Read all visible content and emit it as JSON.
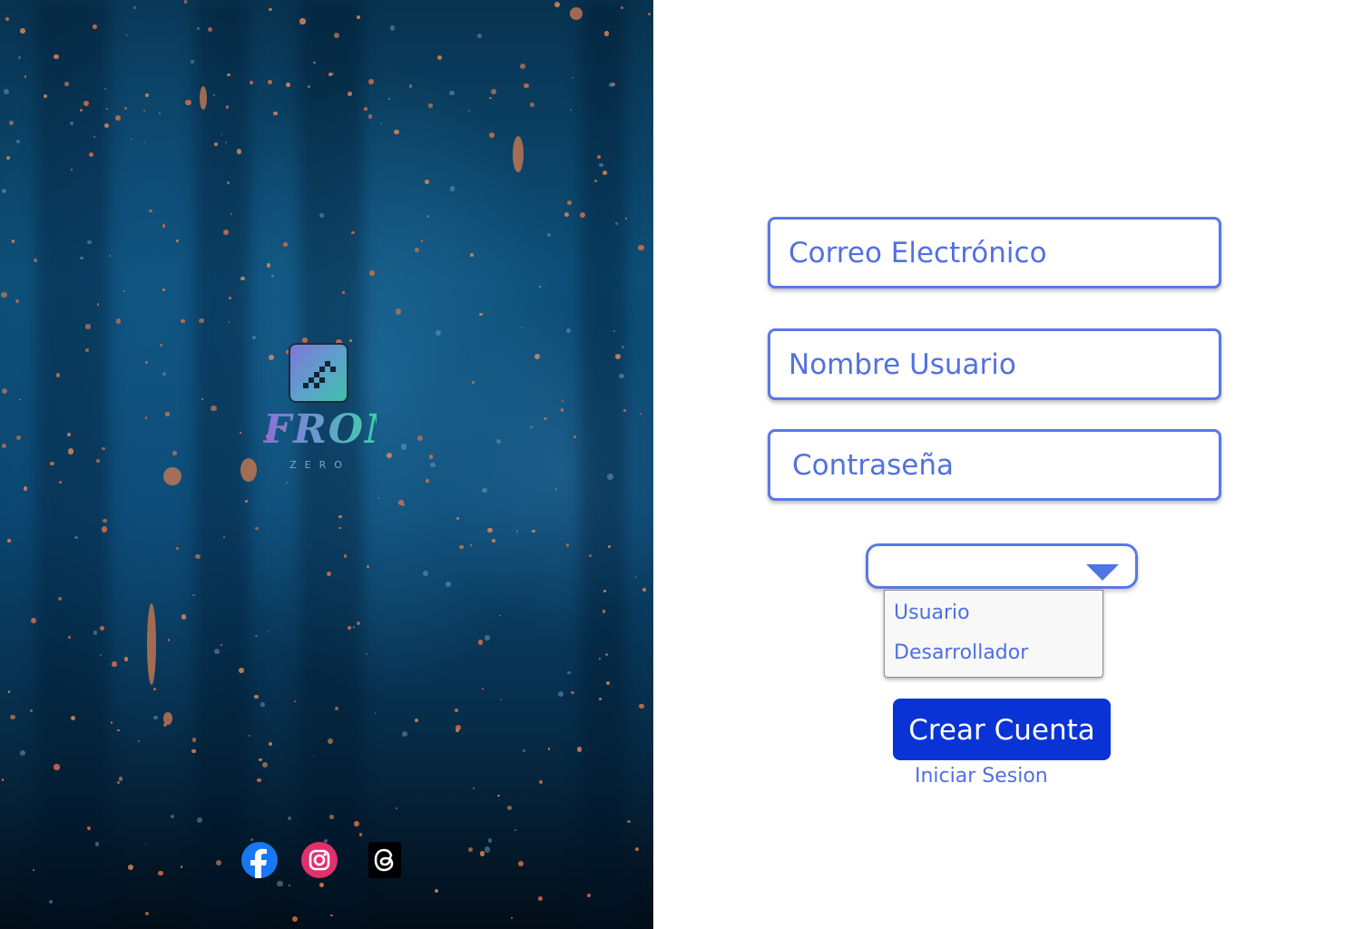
{
  "brand": {
    "logo_word": "FROM",
    "logo_sub": "ZERO"
  },
  "social": [
    {
      "name": "facebook-icon",
      "color": "#1877f2"
    },
    {
      "name": "instagram-icon",
      "color": "#e1306c"
    },
    {
      "name": "threads-icon",
      "color": "#000000"
    }
  ],
  "form": {
    "email_placeholder": "Correo Electrónico",
    "username_placeholder": "Nombre Usuario",
    "password_placeholder": "Contraseña",
    "role_select_value": "",
    "role_options": [
      "Usuario",
      "Desarrollador"
    ],
    "submit_label": "Crear Cuenta",
    "login_link": "Iniciar Sesion"
  },
  "colors": {
    "accent": "#5a78e6",
    "button": "#0a33d6",
    "text": "#4f6fe0"
  }
}
